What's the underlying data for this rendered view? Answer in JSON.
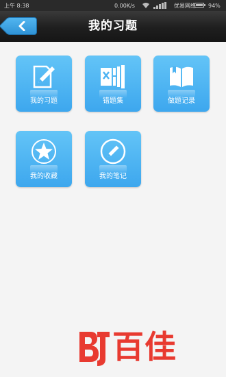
{
  "status_bar": {
    "time": "上午 8:38",
    "net_speed": "0.00K/s",
    "carrier": "优易网络",
    "battery": "94%"
  },
  "header": {
    "title": "我的习题",
    "back_icon": "chevron-left-icon"
  },
  "tiles": [
    {
      "label": "我的习题",
      "icon": "edit-document-icon"
    },
    {
      "label": "错题集",
      "icon": "error-book-icon"
    },
    {
      "label": "做题记录",
      "icon": "open-book-icon"
    },
    {
      "label": "我的收藏",
      "icon": "star-icon"
    },
    {
      "label": "我的笔记",
      "icon": "pencil-circle-icon"
    }
  ],
  "watermark": {
    "brand": "百佳"
  },
  "colors": {
    "tile": "#4db3f2",
    "header": "#222222",
    "background": "#f4f4f4",
    "watermark": "#e83a30"
  }
}
